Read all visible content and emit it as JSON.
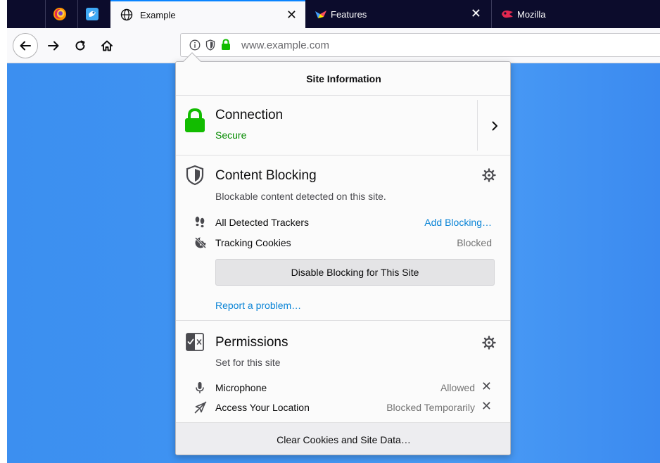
{
  "tabs": [
    {
      "label": "Example",
      "active": true,
      "icon": "globe-icon"
    },
    {
      "label": "Features",
      "active": false,
      "icon": "features-favicon"
    },
    {
      "label": "Mozilla",
      "active": false,
      "icon": "mozilla-favicon"
    }
  ],
  "tab_close_glyph": "✕",
  "pinned_tabs": [
    "firefox-icon",
    "app-icon"
  ],
  "nav": {
    "back": "back-arrow-icon",
    "forward": "forward-arrow-icon",
    "reload": "reload-icon",
    "home": "home-icon"
  },
  "urlbar": {
    "text": "www.example.com"
  },
  "popup": {
    "title": "Site Information",
    "connection": {
      "title": "Connection",
      "status": "Secure"
    },
    "content_blocking": {
      "title": "Content Blocking",
      "description": "Blockable content detected on this site.",
      "rows": [
        {
          "label": "All Detected Trackers",
          "action": "Add Blocking…",
          "icon": "footprints-icon"
        },
        {
          "label": "Tracking Cookies",
          "value": "Blocked",
          "icon": "cookie-blocked-icon"
        }
      ],
      "disable_button": "Disable Blocking for This Site",
      "report_link": "Report a problem…"
    },
    "permissions": {
      "title": "Permissions",
      "description": "Set for this site",
      "rows": [
        {
          "label": "Microphone",
          "value": "Allowed",
          "icon": "microphone-icon"
        },
        {
          "label": "Access Your Location",
          "value": "Blocked Temporarily",
          "icon": "location-blocked-icon"
        }
      ],
      "remove_glyph": "✕"
    },
    "clear_button": "Clear Cookies and Site Data…"
  },
  "colors": {
    "tab_strip": "#0c0c2c",
    "secure_green": "#12bc00",
    "link_blue": "#0a84d6",
    "page_blue": "#3f93f2"
  }
}
